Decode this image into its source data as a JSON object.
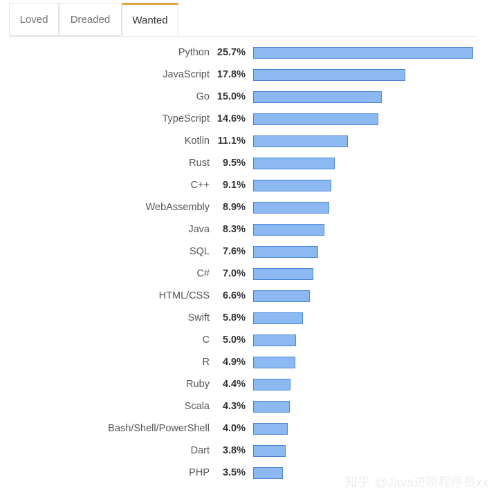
{
  "tabs": [
    {
      "label": "Loved",
      "active": false
    },
    {
      "label": "Dreaded",
      "active": false
    },
    {
      "label": "Wanted",
      "active": true
    }
  ],
  "colors": {
    "bar_fill": "#8cb9f2",
    "bar_border": "#4a86d8",
    "active_tab_indicator": "#dfa43f",
    "tab_border": "#e3e3e3",
    "background": "#ffffff",
    "watermark": "#ededed"
  },
  "watermark": {
    "logo": "知乎",
    "handle": "@Java进阶程序员xx"
  },
  "chart_data": {
    "type": "bar",
    "orientation": "horizontal",
    "title": "",
    "subtitle": "",
    "xlabel": "",
    "ylabel": "",
    "grid": false,
    "legend": null,
    "value_suffix": "%",
    "xlim": [
      0,
      25.7
    ],
    "categories": [
      "Python",
      "JavaScript",
      "Go",
      "TypeScript",
      "Kotlin",
      "Rust",
      "C++",
      "WebAssembly",
      "Java",
      "SQL",
      "C#",
      "HTML/CSS",
      "Swift",
      "C",
      "R",
      "Ruby",
      "Scala",
      "Bash/Shell/PowerShell",
      "Dart",
      "PHP"
    ],
    "values": [
      25.7,
      17.8,
      15.0,
      14.6,
      11.1,
      9.5,
      9.1,
      8.9,
      8.3,
      7.6,
      7.0,
      6.6,
      5.8,
      5.0,
      4.9,
      4.4,
      4.3,
      4.0,
      3.8,
      3.5
    ],
    "value_labels": [
      "25.7%",
      "17.8%",
      "15.0%",
      "14.6%",
      "11.1%",
      "9.5%",
      "9.1%",
      "8.9%",
      "8.3%",
      "7.6%",
      "7.0%",
      "6.6%",
      "5.8%",
      "5.0%",
      "4.9%",
      "4.4%",
      "4.3%",
      "4.0%",
      "3.8%",
      "3.5%"
    ]
  }
}
